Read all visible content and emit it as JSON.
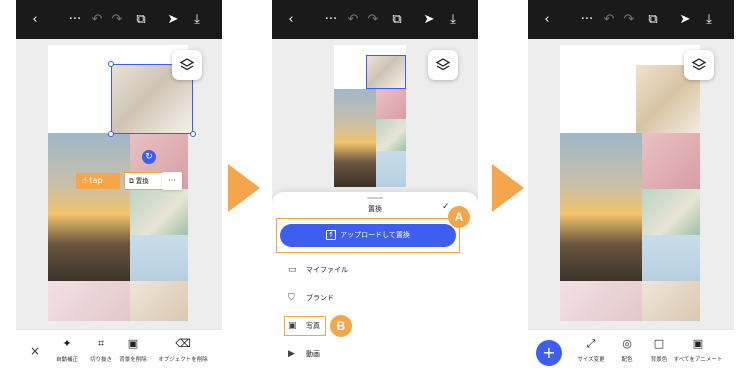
{
  "colors": {
    "accent": "#3d5ef0",
    "highlight": "#f5a54a",
    "topbar": "#1a1a1a"
  },
  "screen1": {
    "topbar_icons": [
      "back-icon",
      "more-icon",
      "undo-icon",
      "redo-icon",
      "pages-icon",
      "share-icon",
      "download-icon"
    ],
    "tap_label": "tap",
    "replace_label": "置換",
    "more_label": "···",
    "toolbar": {
      "close": "×",
      "items": [
        "自動補正",
        "切り抜き",
        "背景を削除",
        "オブジェクトを削除"
      ]
    }
  },
  "screen2": {
    "sheet_title": "置換",
    "upload_button": "アップロードして置換",
    "menu": [
      "マイファイル",
      "ブランド",
      "写真",
      "動画"
    ],
    "badge_a": "A",
    "badge_b": "B"
  },
  "screen3": {
    "add_label": "+",
    "toolbar": {
      "items": [
        "サイズ変更",
        "配色",
        "背景色",
        "すべてをアニメート"
      ]
    }
  }
}
